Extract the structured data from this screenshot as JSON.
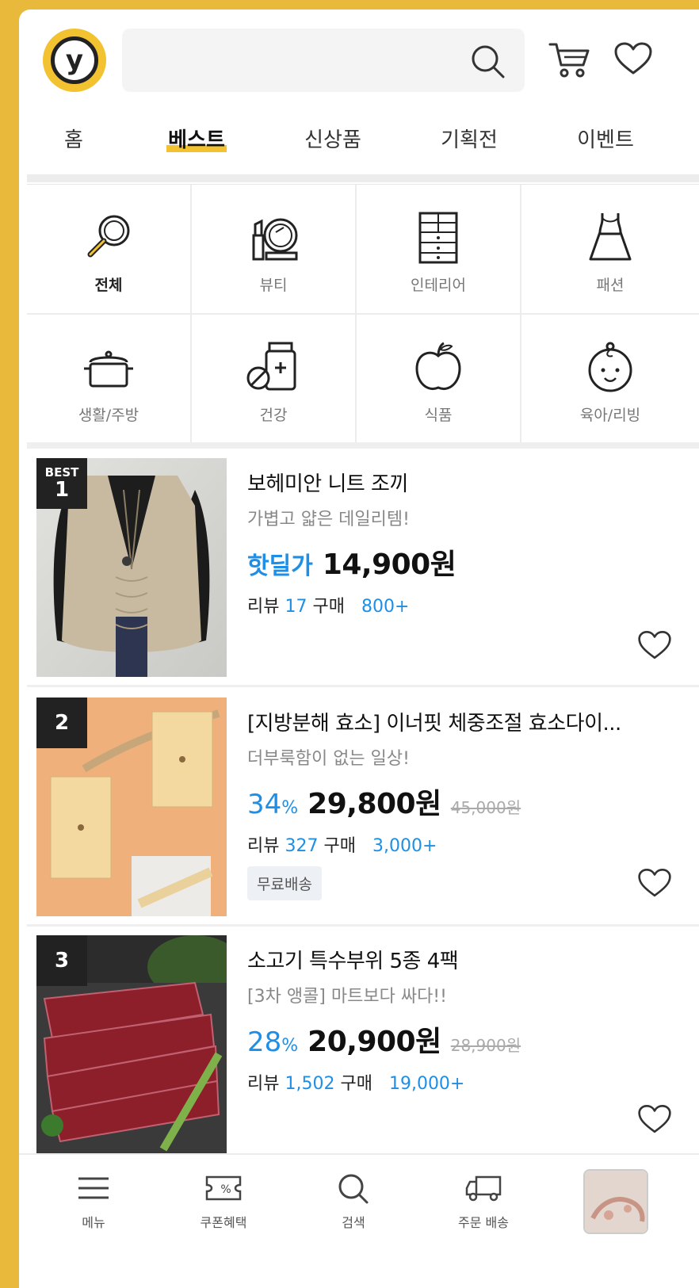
{
  "app": {
    "logo_letter": "y"
  },
  "search": {
    "placeholder": ""
  },
  "tabs": [
    "홈",
    "베스트",
    "신상품",
    "기획전",
    "이벤트"
  ],
  "categories": [
    "전체",
    "뷰티",
    "인테리어",
    "패션",
    "생활/주방",
    "건강",
    "식품",
    "육아/리빙"
  ],
  "products": [
    {
      "badge_top": "BEST",
      "rank": "1",
      "title": "보헤미안 니트 조끼",
      "subtitle": "가볍고 얇은 데일리템!",
      "deal_label": "핫딜가",
      "price": "14,900원",
      "review_label": "리뷰",
      "review_count": "17",
      "buy_label": "구매",
      "buy_count": "800+"
    },
    {
      "rank": "2",
      "title": "[지방분해 효소] 이너핏 체중조절 효소다이...",
      "subtitle": "더부룩함이 없는 일상!",
      "discount": "34",
      "discount_unit": "%",
      "price": "29,800원",
      "original_price": "45,000원",
      "review_label": "리뷰",
      "review_count": "327",
      "buy_label": "구매",
      "buy_count": "3,000+",
      "shipping_badge": "무료배송"
    },
    {
      "rank": "3",
      "title": "소고기 특수부위 5종 4팩",
      "subtitle": "[3차 앵콜] 마트보다 싸다!!",
      "discount": "28",
      "discount_unit": "%",
      "price": "20,900원",
      "original_price": "28,900원",
      "review_label": "리뷰",
      "review_count": "1,502",
      "buy_label": "구매",
      "buy_count": "19,000+"
    }
  ],
  "bottom_nav": [
    "메뉴",
    "쿠폰혜택",
    "검색",
    "주문 배송"
  ],
  "colors": {
    "brand_yellow": "#f3c230",
    "accent_blue": "#1e8fe6",
    "frame_yellow": "#e9b93c"
  },
  "icons": [
    "search-icon",
    "cart-icon",
    "heart-icon",
    "menu-icon",
    "coupon-icon",
    "truck-icon"
  ]
}
